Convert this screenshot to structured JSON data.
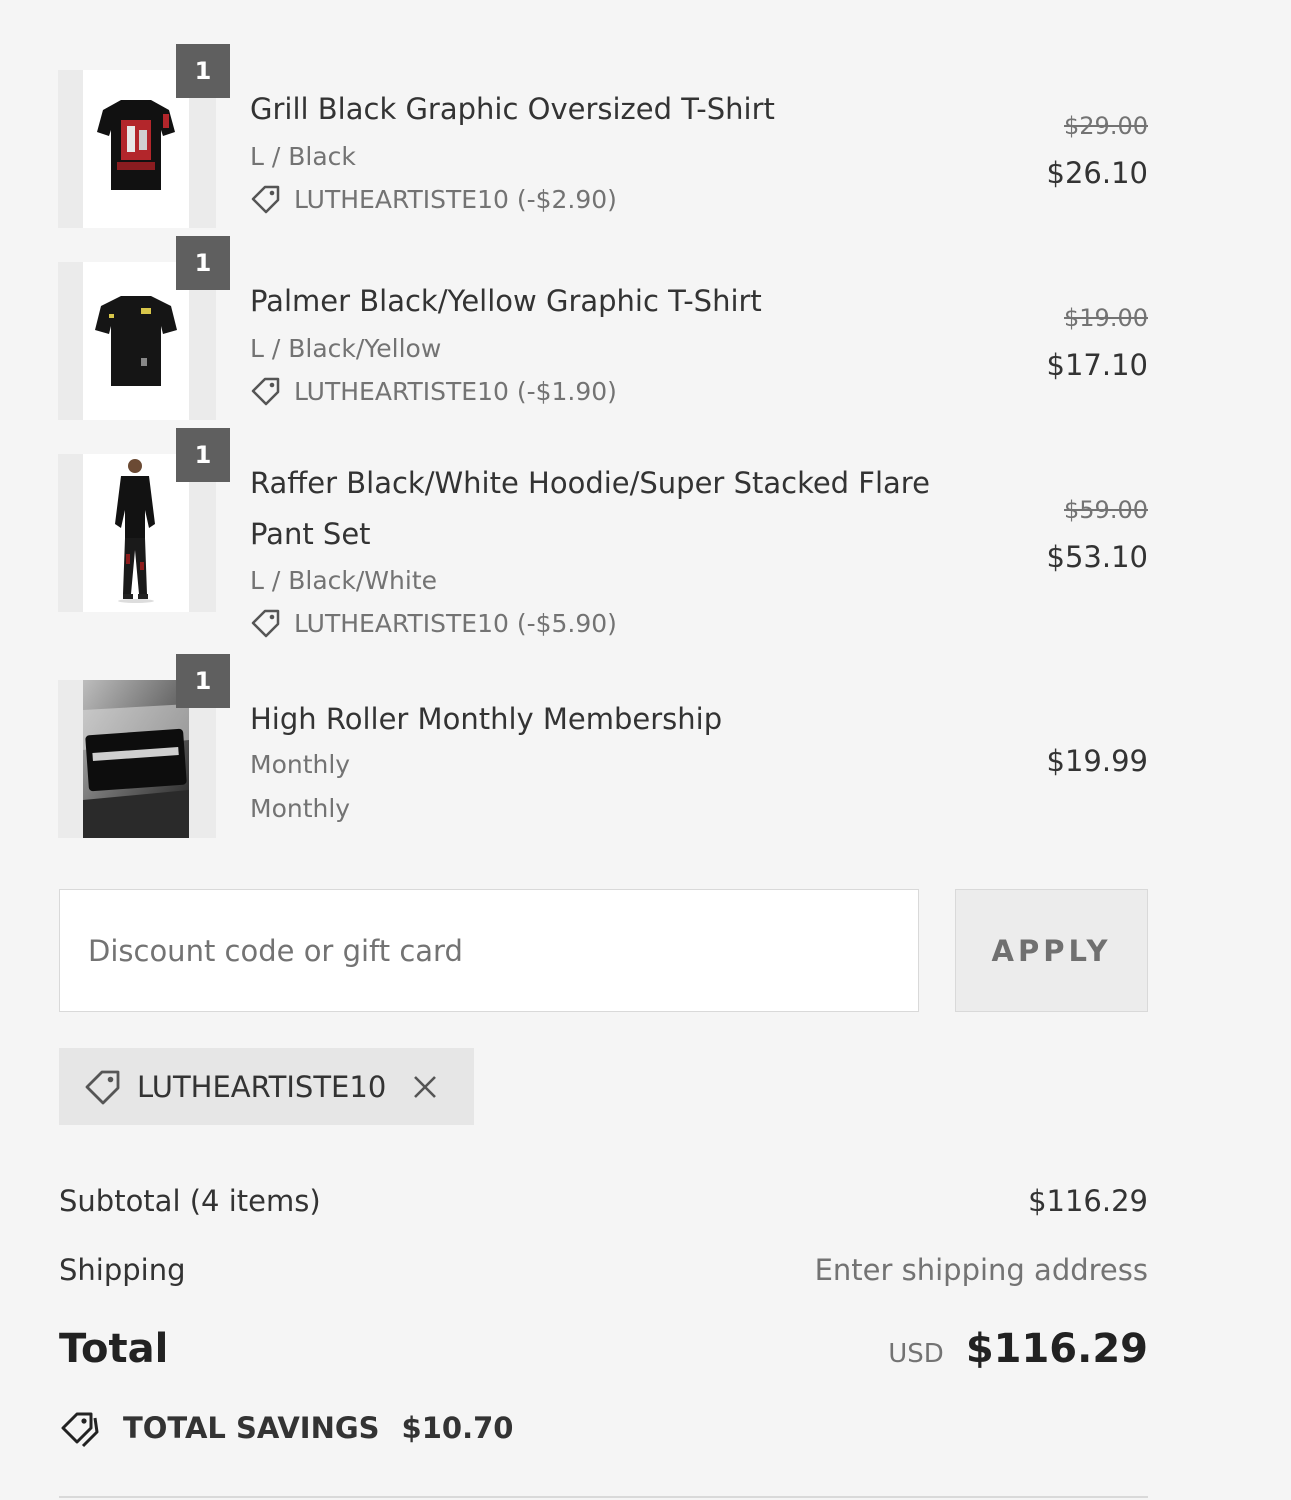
{
  "items": [
    {
      "quantity": "1",
      "name_line1": "Grill Black Graphic Oversized T-Shirt",
      "name_line2": "",
      "variant": "L / Black",
      "discount": "LUTHEARTISTE10 (-$2.90)",
      "original_price": "$29.00",
      "price": "$26.10",
      "image": "black-graphic-tshirt-red-print"
    },
    {
      "quantity": "1",
      "name_line1": "Palmer Black/Yellow Graphic T-Shirt",
      "name_line2": "",
      "variant": "L / Black/Yellow",
      "discount": "LUTHEARTISTE10 (-$1.90)",
      "original_price": "$19.00",
      "price": "$17.10",
      "image": "black-tshirt-yellow-print"
    },
    {
      "quantity": "1",
      "name_line1": "Raffer Black/White Hoodie/Super Stacked Flare",
      "name_line2": "Pant Set",
      "variant": "L / Black/White",
      "discount": "LUTHEARTISTE10 (-$5.90)",
      "original_price": "$59.00",
      "price": "$53.10",
      "image": "model-hoodie-flare-pants"
    },
    {
      "quantity": "1",
      "name_line1": "High Roller Monthly Membership",
      "name_line2": "",
      "variant": "Monthly",
      "variant2": "Monthly",
      "price": "$19.99",
      "image": "high-roller-card"
    }
  ],
  "discount_form": {
    "placeholder": "Discount code or gift card",
    "apply_label": "APPLY"
  },
  "applied_code": "LUTHEARTISTE10",
  "summary": {
    "subtotal_label": "Subtotal (4 items)",
    "subtotal_value": "$116.29",
    "shipping_label": "Shipping",
    "shipping_value": "Enter shipping address",
    "total_label": "Total",
    "currency": "USD",
    "total_value": "$116.29",
    "savings_label": "TOTAL SAVINGS",
    "savings_value": "$10.70"
  },
  "colors": {
    "background": "#f5f5f5",
    "text": "#333333",
    "muted": "#737373",
    "badge": "#5f5f5f"
  }
}
